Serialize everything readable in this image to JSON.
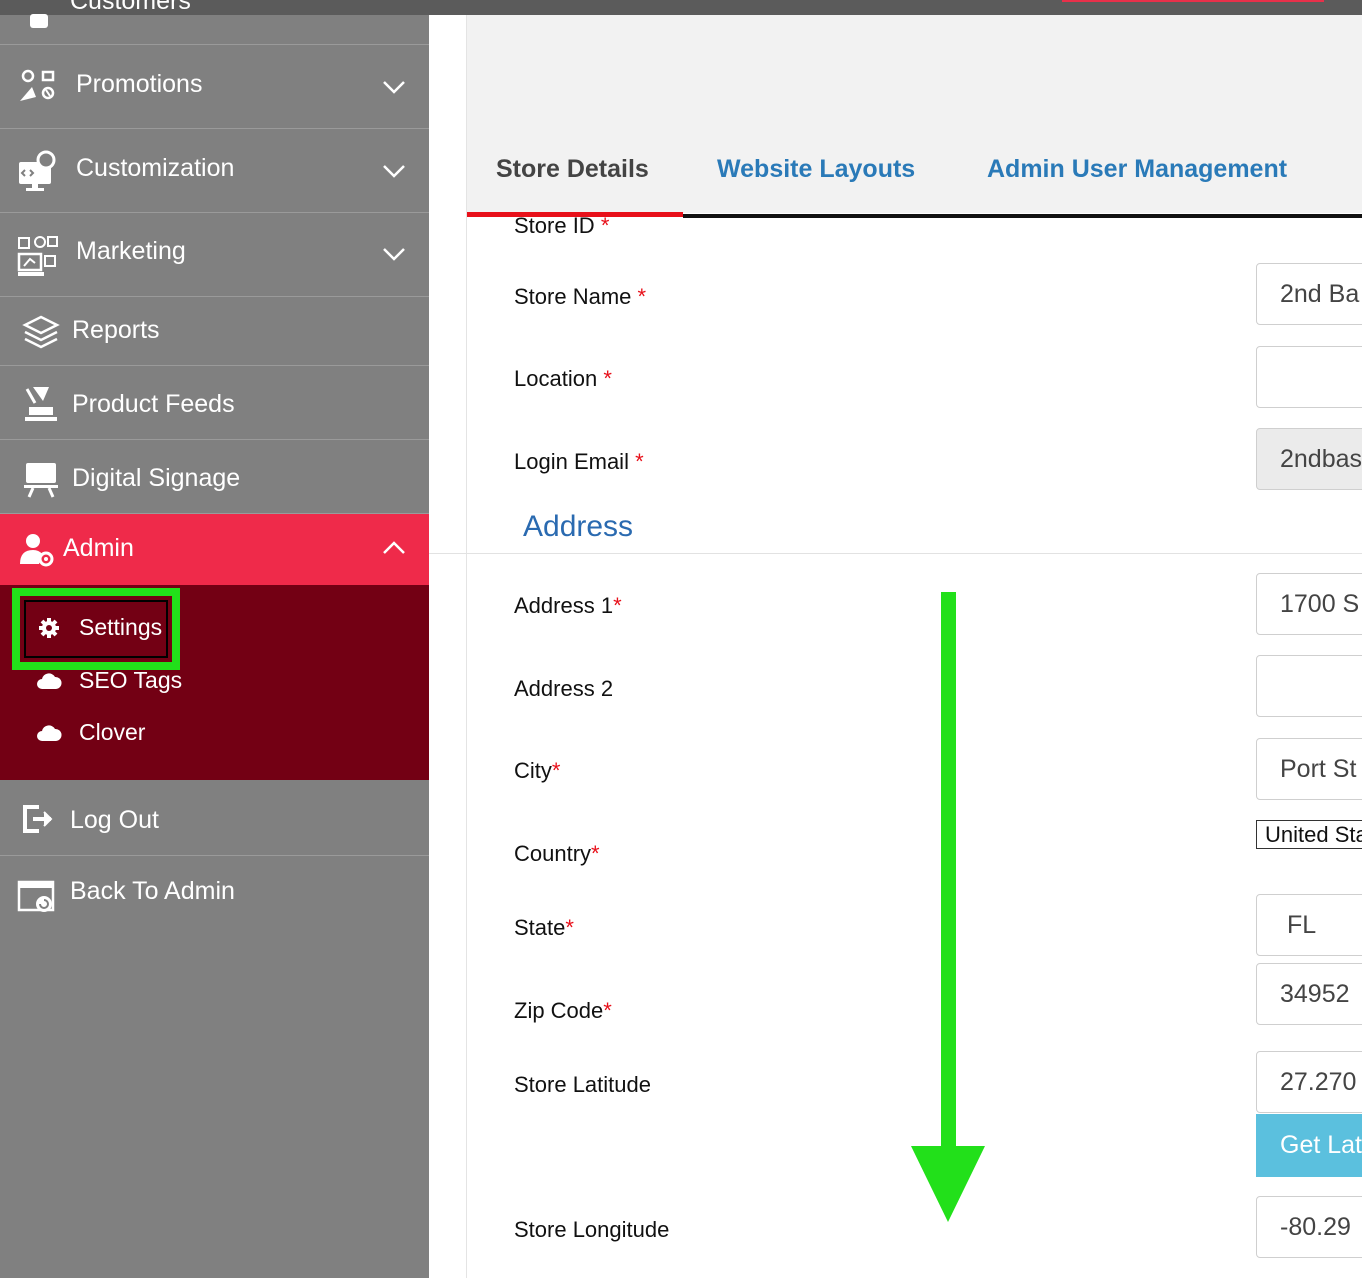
{
  "sidebar": {
    "customers_label": "Customers",
    "items": [
      {
        "label": "Promotions"
      },
      {
        "label": "Customization"
      },
      {
        "label": "Marketing"
      },
      {
        "label": "Reports"
      },
      {
        "label": "Product Feeds"
      },
      {
        "label": "Digital Signage"
      },
      {
        "label": "Admin"
      },
      {
        "label": "Log Out"
      },
      {
        "label": "Back To Admin"
      }
    ],
    "admin_submenu": [
      {
        "label": "Settings"
      },
      {
        "label": "SEO Tags"
      },
      {
        "label": "Clover"
      }
    ]
  },
  "tabs": [
    {
      "label": "Store Details"
    },
    {
      "label": "Website Layouts"
    },
    {
      "label": "Admin User Management"
    }
  ],
  "form": {
    "store_id_label": "Store ID",
    "store_name_label": "Store Name",
    "store_name_value": "2nd Ba",
    "location_label": "Location",
    "location_value": "",
    "login_email_label": "Login Email",
    "login_email_value": "2ndbas",
    "address_section_title": "Address",
    "address1_label": "Address 1",
    "address1_value": "1700 S",
    "address2_label": "Address 2",
    "address2_value": "",
    "city_label": "City",
    "city_value": "Port St",
    "country_label": "Country",
    "country_value": "United Sta",
    "state_label": "State",
    "state_value": "FL",
    "zip_label": "Zip Code",
    "zip_value": "34952",
    "latitude_label": "Store Latitude",
    "latitude_value": "27.270",
    "get_latlong_label": "Get Lat",
    "longitude_label": "Store Longitude",
    "longitude_value": "-80.29",
    "required_mark": "*"
  },
  "colors": {
    "sidebar_bg": "#808080",
    "admin_active": "#ef2a4a",
    "submenu_bg": "#730014",
    "tab_link": "#2a7ab8",
    "highlight": "#22e01a",
    "button": "#5bc0de"
  },
  "icons": {
    "promotions": "promotions-icon",
    "customization": "customization-icon",
    "marketing": "marketing-icon",
    "reports": "layers-icon",
    "product_feeds": "product-feeds-icon",
    "digital_signage": "monitor-icon",
    "admin": "user-gear-icon",
    "settings": "gear-icon",
    "seo": "cloud-icon",
    "clover": "cloud-icon",
    "logout": "logout-icon",
    "back_to_admin": "browser-back-icon",
    "annotation": "down-arrow-icon"
  }
}
